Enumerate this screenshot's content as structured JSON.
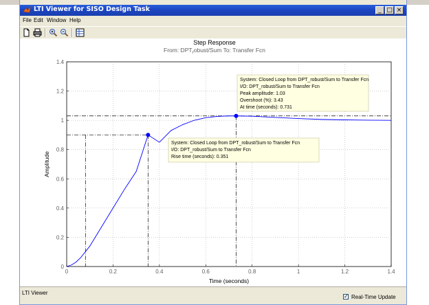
{
  "window": {
    "title": "LTI Viewer for SISO Design Task",
    "controls": {
      "minimize": "_",
      "maximize": "□",
      "close": "×"
    }
  },
  "menu": [
    "File",
    "Edit",
    "Window",
    "Help"
  ],
  "toolbar": {
    "icons": [
      "new-file-icon",
      "print-icon",
      "zoom-in-icon",
      "zoom-out-icon",
      "grid-icon"
    ]
  },
  "plot": {
    "title": "Step Response",
    "subtitle_from": "From: DPT",
    "subtitle_sub": "r",
    "subtitle_rest": "obust/Sum  To: Transfer Fcn"
  },
  "chart_data": {
    "type": "line",
    "title": "Step Response",
    "subtitle": "From: DPT_robust/Sum  To: Transfer Fcn",
    "xlabel": "Time (seconds)",
    "ylabel": "Amplitude",
    "xlim": [
      0,
      1.4
    ],
    "ylim": [
      0,
      1.4
    ],
    "xticks": [
      0,
      0.2,
      0.4,
      0.6,
      0.8,
      1,
      1.2,
      1.4
    ],
    "yticks": [
      0,
      0.2,
      0.4,
      0.6,
      0.8,
      1,
      1.2,
      1.4
    ],
    "xtick_labels": [
      "0",
      "0.2",
      "0.4",
      "0.6",
      "0.8",
      "1",
      "1.2",
      "1.4"
    ],
    "ytick_labels": [
      "0",
      "0.2",
      "0.4",
      "0.6",
      "0.8",
      "1",
      "1.2",
      "1.4"
    ],
    "grid": true,
    "series": [
      {
        "color": "#0000ff",
        "x": [
          0,
          0.02,
          0.04,
          0.06,
          0.08,
          0.1,
          0.15,
          0.2,
          0.25,
          0.3,
          0.351,
          0.4,
          0.45,
          0.5,
          0.55,
          0.6,
          0.65,
          0.7,
          0.731,
          0.8,
          0.9,
          1.0,
          1.1,
          1.2,
          1.3,
          1.4
        ],
        "y": [
          0,
          0.01,
          0.03,
          0.06,
          0.1,
          0.14,
          0.27,
          0.4,
          0.53,
          0.65,
          0.9,
          0.85,
          0.93,
          0.97,
          1.0,
          1.018,
          1.027,
          1.03,
          1.03,
          1.028,
          1.02,
          1.012,
          1.006,
          1.003,
          1.001,
          1.0
        ]
      }
    ],
    "markers": [
      {
        "x": 0.351,
        "y": 0.9
      },
      {
        "x": 0.731,
        "y": 1.03
      }
    ],
    "annotations": [
      {
        "lines": [
          "System: Closed Loop from DPT_robust/Sum to Transfer Fcn",
          "I/O: DPT_robust/Sum to Transfer Fcn",
          "Peak amplitude: 1.03",
          "Overshoot (%): 3.43",
          "At time (seconds): 0.731"
        ]
      },
      {
        "lines": [
          "System: Closed Loop from DPT_robust/Sum to Transfer Fcn",
          "I/O: DPT_robust/Sum to Transfer Fcn",
          "Rise time (seconds): 0.351"
        ]
      }
    ]
  },
  "status": {
    "label": "LTI Viewer",
    "realtime_update": "Real-Time Update",
    "realtime_checked": true
  }
}
